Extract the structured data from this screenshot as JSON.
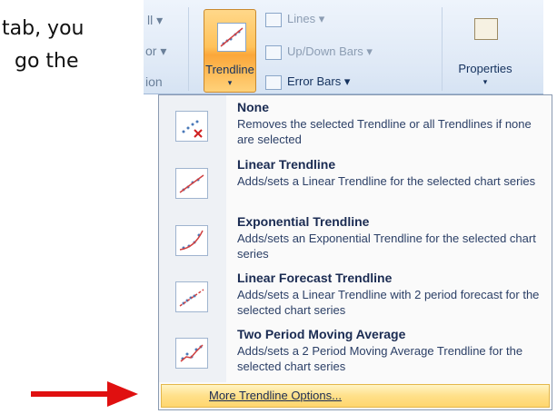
{
  "slide": {
    "line1": "tab, you",
    "line2": "go the"
  },
  "ribbon": {
    "frag1": "ll ▾",
    "frag2": "or ▾",
    "frag3": "ion",
    "trendline_label": "Trendline",
    "lines_label": "Lines ▾",
    "updown_label": "Up/Down Bars ▾",
    "errorbars_label": "Error Bars ▾",
    "properties_label": "Properties",
    "dropdown_glyph": "▾"
  },
  "menu": {
    "items": [
      {
        "title": "None",
        "desc": "Removes the selected Trendline or all Trendlines if none are selected",
        "icon": "trendline-none-icon"
      },
      {
        "title": "Linear Trendline",
        "desc": "Adds/sets a Linear Trendline for the selected chart series",
        "icon": "linear-trendline-icon"
      },
      {
        "title": "Exponential Trendline",
        "desc": "Adds/sets an Exponential Trendline for the selected chart series",
        "icon": "exponential-trendline-icon"
      },
      {
        "title": "Linear Forecast Trendline",
        "desc": "Adds/sets a Linear Trendline with 2 period forecast for the selected chart series",
        "icon": "linear-forecast-trendline-icon"
      },
      {
        "title": "Two Period Moving Average",
        "desc": "Adds/sets a 2 Period Moving Average Trendline for the selected chart series",
        "icon": "moving-average-icon"
      }
    ],
    "more_options": "More Trendline Options..."
  },
  "colors": {
    "arrow": "#e01010",
    "highlight": "#ffd66e",
    "menu_text": "#1a2b52"
  }
}
